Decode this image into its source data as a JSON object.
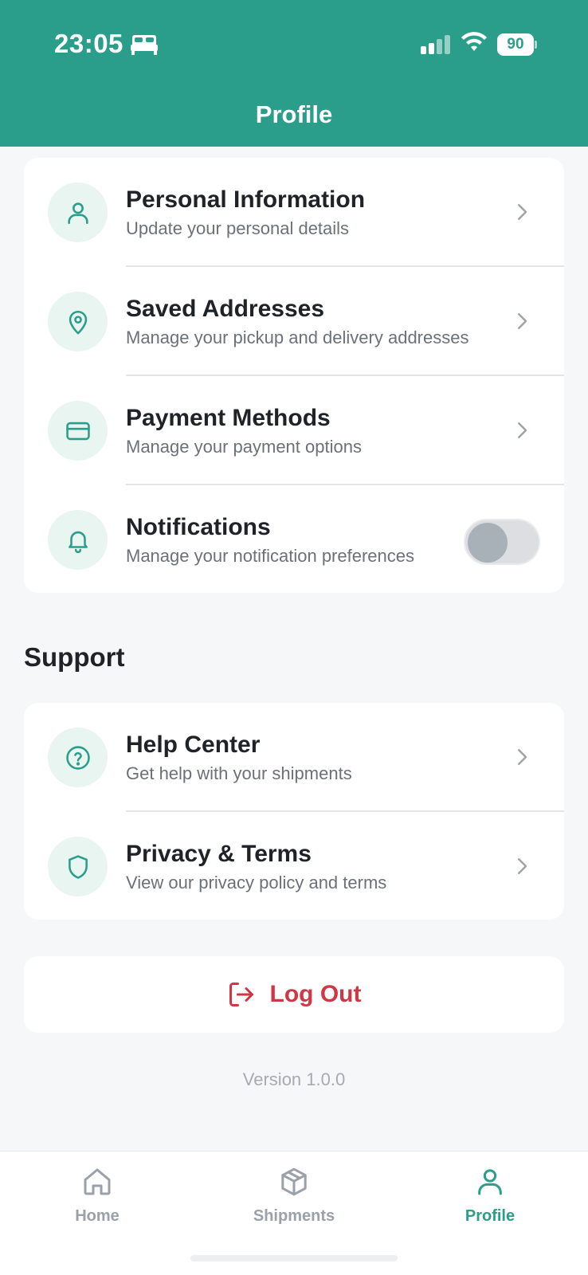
{
  "status_bar": {
    "time": "23:05",
    "battery": "90",
    "icons": [
      "bed-icon",
      "signal-icon",
      "wifi-icon",
      "battery-icon"
    ]
  },
  "header": {
    "title": "Profile"
  },
  "account_items": [
    {
      "title": "Personal Information",
      "subtitle": "Update your personal details",
      "icon": "user-icon"
    },
    {
      "title": "Saved Addresses",
      "subtitle": "Manage your pickup and delivery addresses",
      "icon": "map-pin-icon"
    },
    {
      "title": "Payment Methods",
      "subtitle": "Manage your payment options",
      "icon": "credit-card-icon"
    },
    {
      "title": "Notifications",
      "subtitle": "Manage your notification preferences",
      "icon": "bell-icon",
      "toggle": false
    }
  ],
  "support": {
    "title": "Support",
    "items": [
      {
        "title": "Help Center",
        "subtitle": "Get help with your shipments",
        "icon": "help-circle-icon"
      },
      {
        "title": "Privacy & Terms",
        "subtitle": "View our privacy policy and terms",
        "icon": "shield-icon"
      }
    ]
  },
  "logout": {
    "label": "Log Out",
    "icon": "log-out-icon"
  },
  "version": "Version 1.0.0",
  "bottom_nav": {
    "items": [
      {
        "label": "Home",
        "icon": "home-icon",
        "active": false
      },
      {
        "label": "Shipments",
        "icon": "package-icon",
        "active": false
      },
      {
        "label": "Profile",
        "icon": "user-icon",
        "active": true
      }
    ]
  },
  "colors": {
    "primary": "#2b9e8b",
    "danger": "#d03744",
    "icon_bg": "#e8f5f1",
    "background": "#f5f7f9"
  }
}
